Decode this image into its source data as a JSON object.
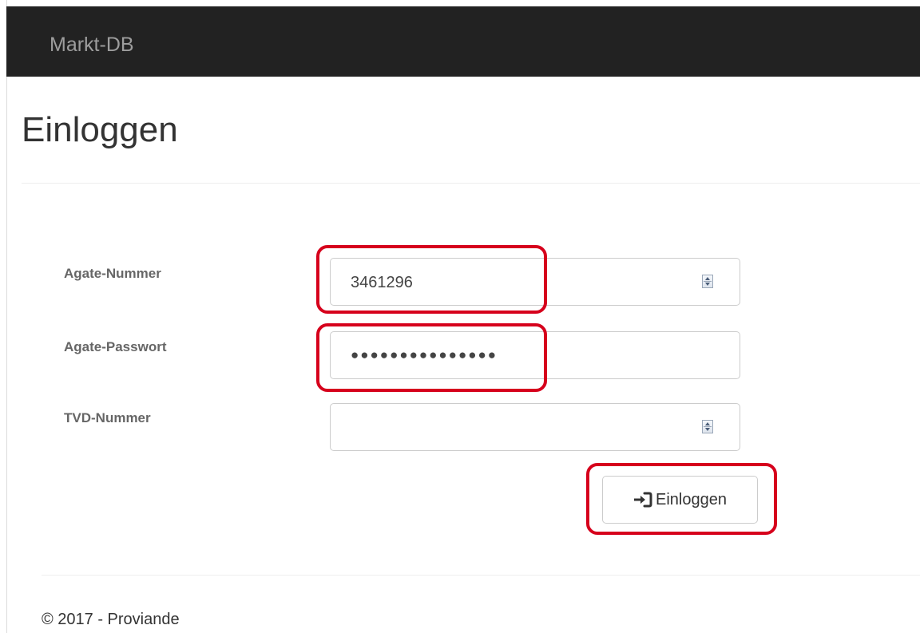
{
  "navbar": {
    "brand": "Markt-DB"
  },
  "page": {
    "title": "Einloggen"
  },
  "form": {
    "agate_nummer": {
      "label": "Agate-Nummer",
      "value": "3461296",
      "type": "number"
    },
    "agate_passwort": {
      "label": "Agate-Passwort",
      "masked_value": "●●●●●●●●●●●●●●●",
      "type": "password"
    },
    "tvd_nummer": {
      "label": "TVD-Nummer",
      "value": "",
      "type": "number"
    },
    "submit": {
      "label": "Einloggen",
      "icon": "sign-in-icon"
    }
  },
  "footer": {
    "text": "© 2017 - Proviande"
  },
  "colors": {
    "navbar_bg": "#222222",
    "brand_text": "#9d9d9d",
    "highlight": "#d6001c"
  }
}
